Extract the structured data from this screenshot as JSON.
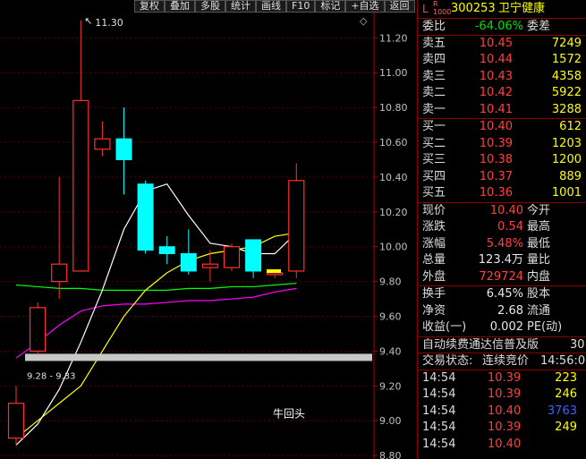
{
  "toolbar": [
    "复权",
    "叠加",
    "多股",
    "统计",
    "画线",
    "F10",
    "标记",
    "+自选",
    "返回"
  ],
  "chart": {
    "y_ticks": [
      "11.20",
      "11.00",
      "10.80",
      "10.60",
      "10.40",
      "10.20",
      "10.00",
      "9.80",
      "9.60",
      "9.40",
      "9.20",
      "9.00",
      "8.80"
    ],
    "high_label": "11.30",
    "range_label": "9.28 - 9.33",
    "annotation": "牛回头",
    "colors": {
      "up": "#ff3030",
      "down": "#00ffff",
      "ma5": "#ffffff",
      "ma10": "#ffff00",
      "ma20": "#ff00ff",
      "ma60": "#00ff00"
    }
  },
  "chart_data": {
    "type": "candlestick",
    "ylim": [
      8.78,
      11.32
    ],
    "candles": [
      {
        "o": 8.9,
        "h": 9.2,
        "l": 8.86,
        "c": 9.1
      },
      {
        "o": 9.4,
        "h": 9.68,
        "l": 9.38,
        "c": 9.65
      },
      {
        "o": 9.8,
        "h": 10.4,
        "l": 9.7,
        "c": 9.9
      },
      {
        "o": 9.86,
        "h": 11.3,
        "l": 9.86,
        "c": 10.84
      },
      {
        "o": 10.56,
        "h": 10.72,
        "l": 10.52,
        "c": 10.62
      },
      {
        "o": 10.62,
        "h": 10.8,
        "l": 10.3,
        "c": 10.5
      },
      {
        "o": 10.36,
        "h": 10.38,
        "l": 9.96,
        "c": 9.98
      },
      {
        "o": 10.0,
        "h": 10.06,
        "l": 9.9,
        "c": 9.96
      },
      {
        "o": 9.96,
        "h": 10.1,
        "l": 9.84,
        "c": 9.86
      },
      {
        "o": 9.88,
        "h": 9.98,
        "l": 9.8,
        "c": 9.9
      },
      {
        "o": 9.88,
        "h": 10.02,
        "l": 9.86,
        "c": 10.0
      },
      {
        "o": 10.04,
        "h": 10.04,
        "l": 9.82,
        "c": 9.86
      },
      {
        "o": 9.84,
        "h": 9.86,
        "l": 9.82,
        "c": 9.85
      },
      {
        "o": 9.86,
        "h": 10.48,
        "l": 9.82,
        "c": 10.38
      }
    ],
    "ma5": [
      8.86,
      8.98,
      9.18,
      9.45,
      9.75,
      10.1,
      10.32,
      10.36,
      10.18,
      10.02,
      10.0,
      9.96,
      9.96,
      10.08
    ],
    "ma10": [
      8.9,
      9.0,
      9.1,
      9.2,
      9.4,
      9.6,
      9.75,
      9.85,
      9.92,
      9.96,
      9.98,
      10.0,
      10.06,
      10.08
    ],
    "ma20": [
      9.36,
      9.45,
      9.55,
      9.63,
      9.66,
      9.67,
      9.67,
      9.68,
      9.69,
      9.69,
      9.7,
      9.71,
      9.74,
      9.76
    ],
    "ma60": [
      9.78,
      9.77,
      9.76,
      9.76,
      9.75,
      9.75,
      9.75,
      9.75,
      9.76,
      9.76,
      9.77,
      9.77,
      9.78,
      9.79
    ]
  },
  "quote": {
    "code": "300253",
    "name": "卫宁健康",
    "weibi_label": "委比",
    "weibi_value": "-64.06%",
    "weicha_label": "委差",
    "asks": [
      {
        "label": "卖五",
        "price": "10.45",
        "vol": "7249"
      },
      {
        "label": "卖四",
        "price": "10.44",
        "vol": "1572"
      },
      {
        "label": "卖三",
        "price": "10.43",
        "vol": "4358"
      },
      {
        "label": "卖二",
        "price": "10.42",
        "vol": "5922"
      },
      {
        "label": "卖一",
        "price": "10.41",
        "vol": "3288"
      }
    ],
    "bids": [
      {
        "label": "买一",
        "price": "10.40",
        "vol": "612"
      },
      {
        "label": "买二",
        "price": "10.39",
        "vol": "1203"
      },
      {
        "label": "买三",
        "price": "10.38",
        "vol": "1200"
      },
      {
        "label": "买四",
        "price": "10.37",
        "vol": "889"
      },
      {
        "label": "买五",
        "price": "10.36",
        "vol": "1001"
      }
    ],
    "stats": [
      {
        "l1": "现价",
        "v1": "10.40",
        "c1": "red",
        "l2": "今开"
      },
      {
        "l1": "涨跌",
        "v1": "0.54",
        "c1": "red",
        "l2": "最高"
      },
      {
        "l1": "涨幅",
        "v1": "5.48%",
        "c1": "red",
        "l2": "最低"
      },
      {
        "l1": "总量",
        "v1": "123.4万",
        "c1": "white",
        "l2": "量比"
      },
      {
        "l1": "外盘",
        "v1": "729724",
        "c1": "red",
        "l2": "内盘"
      }
    ],
    "stats2": [
      {
        "l1": "换手",
        "v1": "6.45%",
        "l2": "股本"
      },
      {
        "l1": "净资",
        "v1": "2.68",
        "l2": "流通"
      },
      {
        "l1": "收益(一)",
        "v1": "0.002",
        "l2": "PE(动)"
      }
    ],
    "banner": "自动续费通达信普及版",
    "banner_extra": "30",
    "trade_status_label": "交易状态:",
    "trade_status_value": "连续竞价",
    "trade_status_time": "14:56:0",
    "ticks": [
      {
        "t": "14:54",
        "p": "10.39",
        "v": "223",
        "vc": "yellow"
      },
      {
        "t": "14:54",
        "p": "10.39",
        "v": "246",
        "vc": "yellow"
      },
      {
        "t": "14:54",
        "p": "10.40",
        "v": "3763",
        "vc": "blue"
      },
      {
        "t": "14:54",
        "p": "10.39",
        "v": "249",
        "vc": "yellow"
      },
      {
        "t": "14:54",
        "p": "10.40",
        "v": "",
        "vc": "yellow"
      }
    ]
  }
}
